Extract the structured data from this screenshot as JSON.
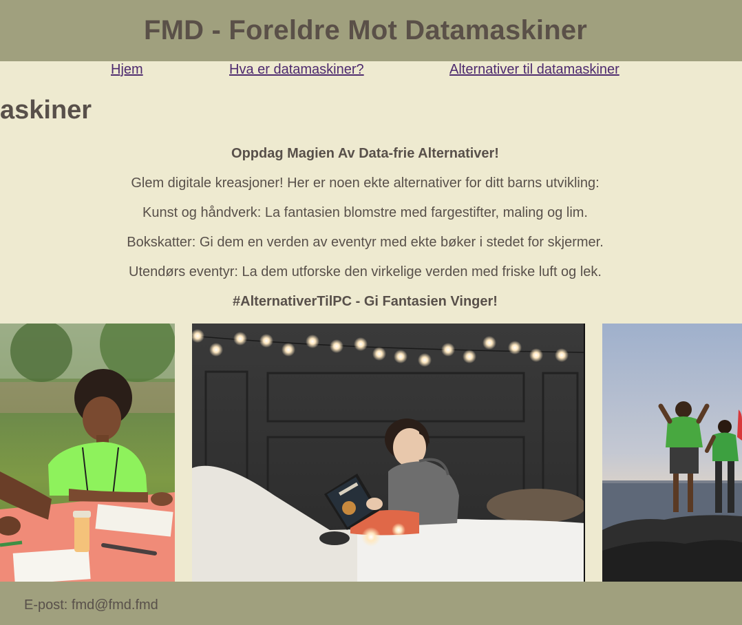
{
  "header": {
    "title": "FMD - Foreldre Mot Datamaskiner"
  },
  "nav": {
    "items": [
      {
        "label": "Hjem"
      },
      {
        "label": "Hva er datamaskiner?"
      },
      {
        "label": "Alternativer til datamaskiner"
      }
    ]
  },
  "page": {
    "heading_visible": "askiner"
  },
  "content": {
    "tagline": "Oppdag Magien Av Data-frie Alternativer!",
    "intro": "Glem digitale kreasjoner! Her er noen ekte alternativer for ditt barns utvikling:",
    "item1": "Kunst og håndverk: La fantasien blomstre med fargestifter, maling og lim.",
    "item2": "Bokskatter: Gi dem en verden av eventyr med ekte bøker i stedet for skjermer.",
    "item3": "Utendørs eventyr: La dem utforske den virkelige verden med friske luft og lek.",
    "hashtag": "#AlternativerTilPC - Gi Fantasien Vinger!"
  },
  "gallery": {
    "images": [
      {
        "subject": "child-drawing-outdoors"
      },
      {
        "subject": "child-reading-book-in-bed"
      },
      {
        "subject": "children-jumping-on-rocks-by-sea"
      }
    ]
  },
  "footer": {
    "email": "E-post: fmd@fmd.fmd"
  }
}
